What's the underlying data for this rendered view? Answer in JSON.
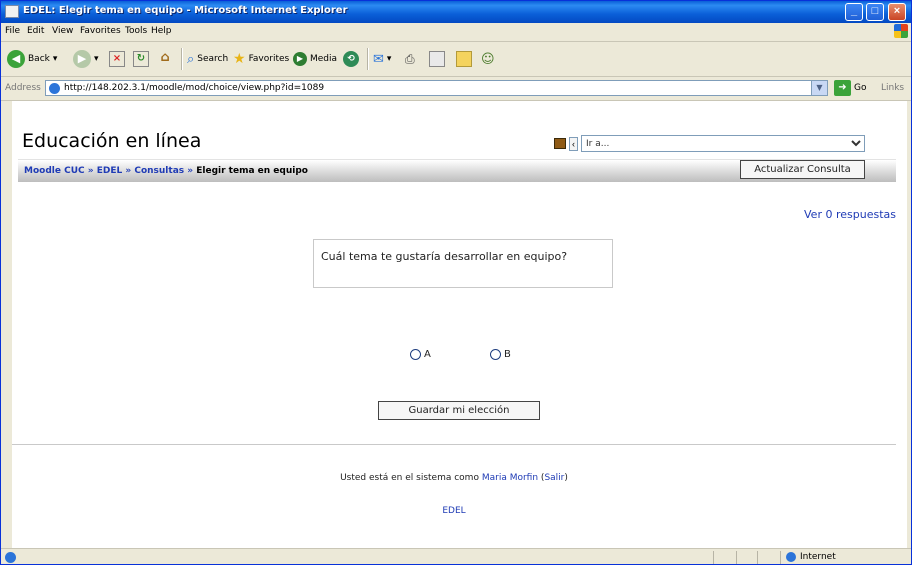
{
  "window": {
    "title": "EDEL: Elegir tema en equipo - Microsoft Internet Explorer"
  },
  "menu": [
    "File",
    "Edit",
    "View",
    "Favorites",
    "Tools",
    "Help"
  ],
  "toolbar": {
    "back": "Back",
    "search": "Search",
    "favorites": "Favorites",
    "media": "Media"
  },
  "address": {
    "label": "Address",
    "url": "http://148.202.3.1/moodle/mod/choice/view.php?id=1089",
    "go": "Go",
    "links": "Links"
  },
  "page": {
    "site_title": "Educación en línea",
    "jump_placeholder": "Ir a...",
    "breadcrumb": {
      "home": "Moodle CUC",
      "course": "EDEL",
      "section": "Consultas",
      "current": "Elegir tema en equipo",
      "sep": "»"
    },
    "update_button": "Actualizar Consulta",
    "view_responses": "Ver 0 respuestas",
    "question": "Cuál tema te gustaría desarrollar en equipo?",
    "options": [
      "A",
      "B"
    ],
    "save_button": "Guardar mi elección",
    "logged_prefix": "Usted está en el sistema como",
    "user": "Maria Morfin",
    "logout": "Salir",
    "footer_link": "EDEL"
  },
  "status": {
    "zone": "Internet"
  }
}
